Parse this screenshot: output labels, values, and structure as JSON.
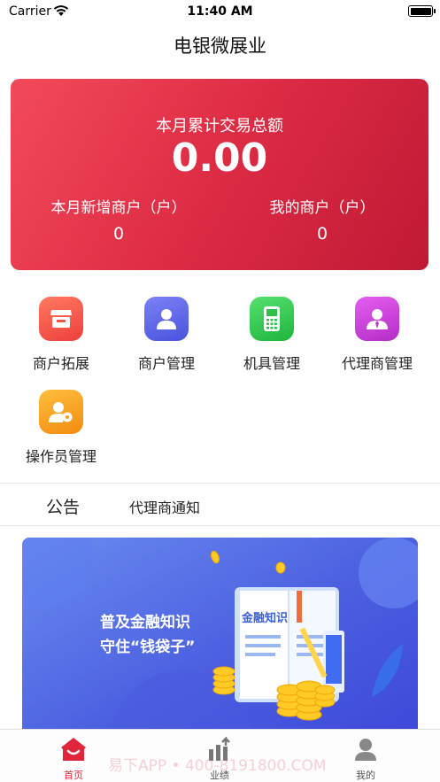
{
  "status_bar": {
    "carrier": "Carrier",
    "time": "11:40 AM"
  },
  "nav": {
    "title": "电银微展业"
  },
  "summary": {
    "title": "本月累计交易总额",
    "total": "0.00",
    "new_merchants_label": "本月新增商户（户）",
    "new_merchants_value": "0",
    "my_merchants_label": "我的商户（户）",
    "my_merchants_value": "0"
  },
  "menu": {
    "items": [
      {
        "label": "商户拓展",
        "icon": "shop-icon",
        "color": "#f25a48"
      },
      {
        "label": "商户管理",
        "icon": "user-icon",
        "color": "#5a62e8"
      },
      {
        "label": "机具管理",
        "icon": "pos-terminal-icon",
        "color": "#2fcc4a"
      },
      {
        "label": "代理商管理",
        "icon": "agent-icon",
        "color": "#cc3bd8"
      },
      {
        "label": "操作员管理",
        "icon": "operator-settings-icon",
        "color": "#f7a11a"
      }
    ]
  },
  "notice_tabs": {
    "announcement": "公告",
    "agent_notice": "代理商通知"
  },
  "banner": {
    "line1": "普及金融知识",
    "line2": "守住“钱袋子”",
    "book_title": "金融知识"
  },
  "tab_bar": {
    "items": [
      {
        "label": "首页",
        "icon": "home-icon",
        "active": true
      },
      {
        "label": "业绩",
        "icon": "performance-icon",
        "active": false
      },
      {
        "label": "我的",
        "icon": "profile-icon",
        "active": false
      }
    ],
    "active_color": "#e0263c",
    "watermark": "易下APP • 400-8191800.COM"
  }
}
